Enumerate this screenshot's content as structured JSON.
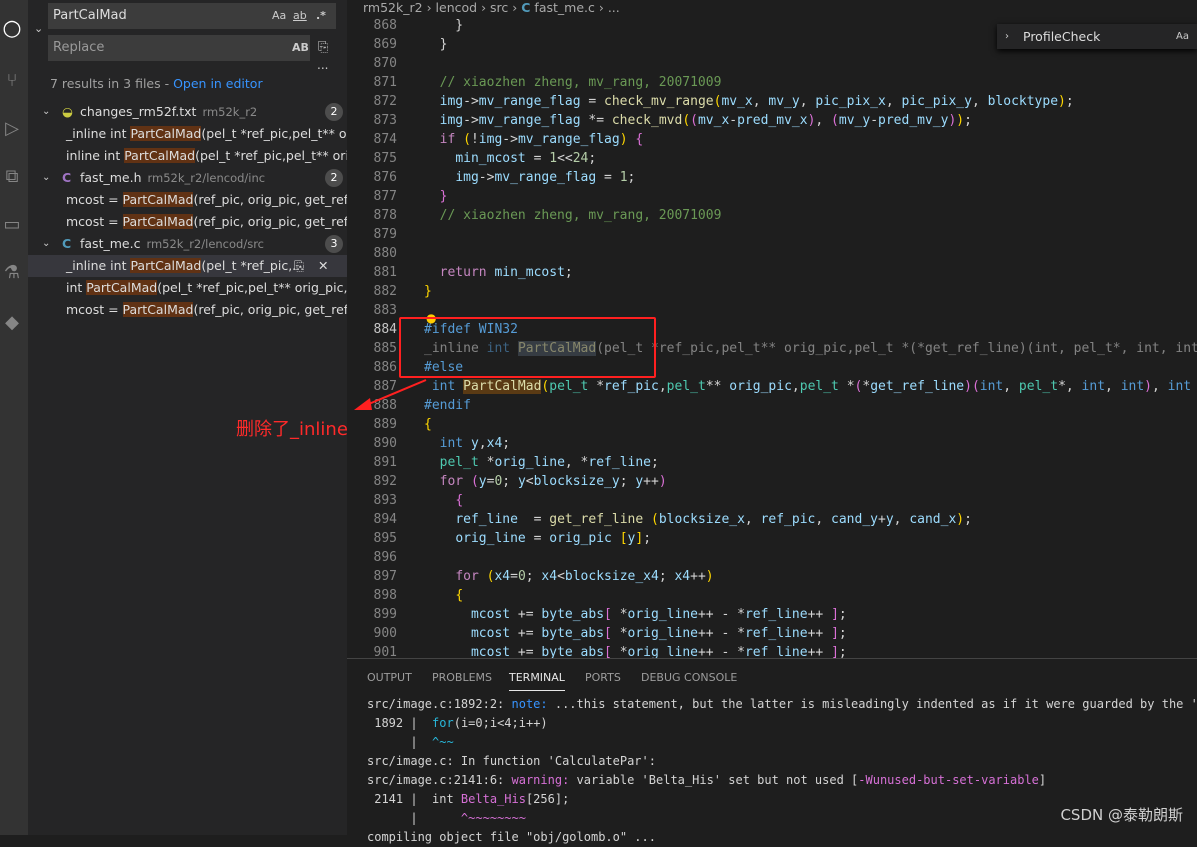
{
  "activity_bar": {
    "icons": [
      "search-icon",
      "source-control-icon",
      "run-debug-icon",
      "extensions-icon",
      "remote-explorer-icon",
      "testing-icon",
      "git-lens-icon"
    ]
  },
  "search": {
    "query": "PartCalMad",
    "replace_placeholder": "Replace",
    "match_case": "Aa",
    "whole_word": "ab",
    "regex": ".*",
    "preserve_case": "AB",
    "more": "...",
    "summary": "7 results in 3 files - ",
    "open_in_editor": "Open in editor"
  },
  "results": [
    {
      "name": "changes_rm52f.txt",
      "path": "rm52k_r2",
      "count": "2",
      "icon": "text-file-icon",
      "matches": [
        [
          "_inline int ",
          "PartCalMad",
          "(pel_t *ref_pic,pel_t** orig..."
        ],
        [
          "inline int ",
          "PartCalMad",
          "(pel_t *ref_pic,pel_t** orig_..."
        ]
      ]
    },
    {
      "name": "fast_me.h",
      "path": "rm52k_r2/lencod/inc",
      "count": "2",
      "icon": "C",
      "matches": [
        [
          "mcost = ",
          "PartCalMad",
          "(ref_pic, orig_pic, get_ref_li..."
        ],
        [
          "mcost = ",
          "PartCalMad",
          "(ref_pic, orig_pic, get_ref_li..."
        ]
      ]
    },
    {
      "name": "fast_me.c",
      "path": "rm52k_r2/lencod/src",
      "count": "3",
      "icon": "C",
      "matches": [
        [
          "_inline int ",
          "PartCalMad",
          "(pel_t *ref_pic,..."
        ],
        [
          "int ",
          "PartCalMad",
          "(pel_t *ref_pic,pel_t** orig_pic,pe..."
        ],
        [
          "mcost = ",
          "PartCalMad",
          "(ref_pic, orig_pic, get_ref_li..."
        ]
      ]
    }
  ],
  "breadcrumb": [
    "rm52k_r2",
    "lencod",
    "src",
    "fast_me.c",
    "..."
  ],
  "find_widget": {
    "value": "ProfileCheck",
    "match_case": "Aa"
  },
  "code": {
    "current_line": 884,
    "lines": [
      [
        868,
        [
          [
            "tx",
            "    }"
          ]
        ]
      ],
      [
        869,
        [
          [
            "tx",
            "  }"
          ]
        ]
      ],
      [
        870,
        []
      ],
      [
        871,
        [
          [
            "cm",
            "  // xiaozhen zheng, mv_rang, 20071009"
          ]
        ]
      ],
      [
        872,
        [
          [
            "tx",
            "  "
          ],
          [
            "vr",
            "img"
          ],
          [
            "tx",
            "->"
          ],
          [
            "vr",
            "mv_range_flag"
          ],
          [
            "tx",
            " = "
          ],
          [
            "fn",
            "check_mv_range"
          ],
          [
            "br",
            "("
          ],
          [
            "vr",
            "mv_x"
          ],
          [
            "tx",
            ", "
          ],
          [
            "vr",
            "mv_y"
          ],
          [
            "tx",
            ", "
          ],
          [
            "vr",
            "pic_pix_x"
          ],
          [
            "tx",
            ", "
          ],
          [
            "vr",
            "pic_pix_y"
          ],
          [
            "tx",
            ", "
          ],
          [
            "vr",
            "blocktype"
          ],
          [
            "br",
            ")"
          ],
          [
            "tx",
            ";"
          ]
        ]
      ],
      [
        873,
        [
          [
            "tx",
            "  "
          ],
          [
            "vr",
            "img"
          ],
          [
            "tx",
            "->"
          ],
          [
            "vr",
            "mv_range_flag"
          ],
          [
            "tx",
            " *= "
          ],
          [
            "fn",
            "check_mvd"
          ],
          [
            "br",
            "("
          ],
          [
            "bp",
            "("
          ],
          [
            "vr",
            "mv_x"
          ],
          [
            "tx",
            "-"
          ],
          [
            "vr",
            "pred_mv_x"
          ],
          [
            "bp",
            ")"
          ],
          [
            "tx",
            ", "
          ],
          [
            "bp",
            "("
          ],
          [
            "vr",
            "mv_y"
          ],
          [
            "tx",
            "-"
          ],
          [
            "vr",
            "pred_mv_y"
          ],
          [
            "bp",
            ")"
          ],
          [
            "br",
            ")"
          ],
          [
            "tx",
            ";"
          ]
        ]
      ],
      [
        874,
        [
          [
            "tx",
            "  "
          ],
          [
            "pp",
            "if"
          ],
          [
            "tx",
            " "
          ],
          [
            "br",
            "("
          ],
          [
            "tx",
            "!"
          ],
          [
            "vr",
            "img"
          ],
          [
            "tx",
            "->"
          ],
          [
            "vr",
            "mv_range_flag"
          ],
          [
            "br",
            ")"
          ],
          [
            "tx",
            " "
          ],
          [
            "bp",
            "{"
          ]
        ]
      ],
      [
        875,
        [
          [
            "tx",
            "    "
          ],
          [
            "vr",
            "min_mcost"
          ],
          [
            "tx",
            " = "
          ],
          [
            "nm",
            "1"
          ],
          [
            "tx",
            "<<"
          ],
          [
            "nm",
            "24"
          ],
          [
            "tx",
            ";"
          ]
        ]
      ],
      [
        876,
        [
          [
            "tx",
            "    "
          ],
          [
            "vr",
            "img"
          ],
          [
            "tx",
            "->"
          ],
          [
            "vr",
            "mv_range_flag"
          ],
          [
            "tx",
            " = "
          ],
          [
            "nm",
            "1"
          ],
          [
            "tx",
            ";"
          ]
        ]
      ],
      [
        877,
        [
          [
            "tx",
            "  "
          ],
          [
            "bp",
            "}"
          ]
        ]
      ],
      [
        878,
        [
          [
            "cm",
            "  // xiaozhen zheng, mv_rang, 20071009"
          ]
        ]
      ],
      [
        879,
        []
      ],
      [
        880,
        []
      ],
      [
        881,
        [
          [
            "tx",
            "  "
          ],
          [
            "pp",
            "return"
          ],
          [
            "tx",
            " "
          ],
          [
            "vr",
            "min_mcost"
          ],
          [
            "tx",
            ";"
          ]
        ]
      ],
      [
        882,
        [
          [
            "br",
            "}"
          ]
        ]
      ],
      [
        883,
        []
      ],
      [
        884,
        [
          [
            "kw",
            "#ifdef"
          ],
          [
            "tx",
            " "
          ],
          [
            "kw",
            "WIN32"
          ]
        ]
      ],
      [
        885,
        [
          [
            "dim",
            "_inline "
          ],
          [
            "dimkw",
            "int "
          ],
          [
            "hlw",
            "PartCalMad"
          ],
          [
            "dim",
            "(pel_t *ref_pic,pel_t** orig_pic,pel_t *(*get_ref_line)(int, pel_t*, int, int), int bl"
          ]
        ]
      ],
      [
        886,
        [
          [
            "kw",
            "#else"
          ]
        ]
      ],
      [
        887,
        [
          [
            "tx",
            " "
          ],
          [
            "kw",
            "int"
          ],
          [
            "tx",
            " "
          ],
          [
            "hlm",
            "PartCalMad"
          ],
          [
            "br",
            "("
          ],
          [
            "ty",
            "pel_t"
          ],
          [
            "tx",
            " *"
          ],
          [
            "vr",
            "ref_pic"
          ],
          [
            "tx",
            ","
          ],
          [
            "ty",
            "pel_t"
          ],
          [
            "tx",
            "** "
          ],
          [
            "vr",
            "orig_pic"
          ],
          [
            "tx",
            ","
          ],
          [
            "ty",
            "pel_t"
          ],
          [
            "tx",
            " *"
          ],
          [
            "bp",
            "("
          ],
          [
            "tx",
            "*"
          ],
          [
            "vr",
            "get_ref_line"
          ],
          [
            "bp",
            ")"
          ],
          [
            "bp",
            "("
          ],
          [
            "kw",
            "int"
          ],
          [
            "tx",
            ", "
          ],
          [
            "ty",
            "pel_t"
          ],
          [
            "tx",
            "*, "
          ],
          [
            "kw",
            "int"
          ],
          [
            "tx",
            ", "
          ],
          [
            "kw",
            "int"
          ],
          [
            "bp",
            ")"
          ],
          [
            "tx",
            ", "
          ],
          [
            "kw",
            "int"
          ],
          [
            "tx",
            " bl"
          ]
        ]
      ],
      [
        888,
        [
          [
            "kw",
            "#endif"
          ]
        ]
      ],
      [
        889,
        [
          [
            "br",
            "{"
          ]
        ]
      ],
      [
        890,
        [
          [
            "tx",
            "  "
          ],
          [
            "kw",
            "int"
          ],
          [
            "tx",
            " "
          ],
          [
            "vr",
            "y"
          ],
          [
            "tx",
            ","
          ],
          [
            "vr",
            "x4"
          ],
          [
            "tx",
            ";"
          ]
        ]
      ],
      [
        891,
        [
          [
            "tx",
            "  "
          ],
          [
            "ty",
            "pel_t"
          ],
          [
            "tx",
            " *"
          ],
          [
            "vr",
            "orig_line"
          ],
          [
            "tx",
            ", *"
          ],
          [
            "vr",
            "ref_line"
          ],
          [
            "tx",
            ";"
          ]
        ]
      ],
      [
        892,
        [
          [
            "tx",
            "  "
          ],
          [
            "pp",
            "for"
          ],
          [
            "tx",
            " "
          ],
          [
            "bp",
            "("
          ],
          [
            "vr",
            "y"
          ],
          [
            "tx",
            "="
          ],
          [
            "nm",
            "0"
          ],
          [
            "tx",
            "; "
          ],
          [
            "vr",
            "y"
          ],
          [
            "tx",
            "<"
          ],
          [
            "vr",
            "blocksize_y"
          ],
          [
            "tx",
            "; "
          ],
          [
            "vr",
            "y"
          ],
          [
            "tx",
            "++"
          ],
          [
            "bp",
            ")"
          ]
        ]
      ],
      [
        893,
        [
          [
            "tx",
            "    "
          ],
          [
            "bp",
            "{"
          ]
        ]
      ],
      [
        894,
        [
          [
            "tx",
            "    "
          ],
          [
            "vr",
            "ref_line"
          ],
          [
            "tx",
            "  = "
          ],
          [
            "fn",
            "get_ref_line"
          ],
          [
            "tx",
            " "
          ],
          [
            "br",
            "("
          ],
          [
            "vr",
            "blocksize_x"
          ],
          [
            "tx",
            ", "
          ],
          [
            "vr",
            "ref_pic"
          ],
          [
            "tx",
            ", "
          ],
          [
            "vr",
            "cand_y"
          ],
          [
            "tx",
            "+"
          ],
          [
            "vr",
            "y"
          ],
          [
            "tx",
            ", "
          ],
          [
            "vr",
            "cand_x"
          ],
          [
            "br",
            ")"
          ],
          [
            "tx",
            ";"
          ]
        ]
      ],
      [
        895,
        [
          [
            "tx",
            "    "
          ],
          [
            "vr",
            "orig_line"
          ],
          [
            "tx",
            " = "
          ],
          [
            "vr",
            "orig_pic"
          ],
          [
            "tx",
            " "
          ],
          [
            "br",
            "["
          ],
          [
            "vr",
            "y"
          ],
          [
            "br",
            "]"
          ],
          [
            "tx",
            ";"
          ]
        ]
      ],
      [
        896,
        []
      ],
      [
        897,
        [
          [
            "tx",
            "    "
          ],
          [
            "pp",
            "for"
          ],
          [
            "tx",
            " "
          ],
          [
            "br",
            "("
          ],
          [
            "vr",
            "x4"
          ],
          [
            "tx",
            "="
          ],
          [
            "nm",
            "0"
          ],
          [
            "tx",
            "; "
          ],
          [
            "vr",
            "x4"
          ],
          [
            "tx",
            "<"
          ],
          [
            "vr",
            "blocksize_x4"
          ],
          [
            "tx",
            "; "
          ],
          [
            "vr",
            "x4"
          ],
          [
            "tx",
            "++"
          ],
          [
            "br",
            ")"
          ]
        ]
      ],
      [
        898,
        [
          [
            "tx",
            "    "
          ],
          [
            "br",
            "{"
          ]
        ]
      ],
      [
        899,
        [
          [
            "tx",
            "      "
          ],
          [
            "vr",
            "mcost"
          ],
          [
            "tx",
            " += "
          ],
          [
            "vr",
            "byte_abs"
          ],
          [
            "bp",
            "["
          ],
          [
            "tx",
            " *"
          ],
          [
            "vr",
            "orig_line"
          ],
          [
            "tx",
            "++ - *"
          ],
          [
            "vr",
            "ref_line"
          ],
          [
            "tx",
            "++ "
          ],
          [
            "bp",
            "]"
          ],
          [
            "tx",
            ";"
          ]
        ]
      ],
      [
        900,
        [
          [
            "tx",
            "      "
          ],
          [
            "vr",
            "mcost"
          ],
          [
            "tx",
            " += "
          ],
          [
            "vr",
            "byte_abs"
          ],
          [
            "bp",
            "["
          ],
          [
            "tx",
            " *"
          ],
          [
            "vr",
            "orig_line"
          ],
          [
            "tx",
            "++ - *"
          ],
          [
            "vr",
            "ref_line"
          ],
          [
            "tx",
            "++ "
          ],
          [
            "bp",
            "]"
          ],
          [
            "tx",
            ";"
          ]
        ]
      ],
      [
        901,
        [
          [
            "tx",
            "      "
          ],
          [
            "vr",
            "mcost"
          ],
          [
            "tx",
            " += "
          ],
          [
            "vr",
            "byte_abs"
          ],
          [
            "bp",
            "["
          ],
          [
            "tx",
            " *"
          ],
          [
            "vr",
            "orig_line"
          ],
          [
            "tx",
            "++ - *"
          ],
          [
            "vr",
            "ref_line"
          ],
          [
            "tx",
            "++ "
          ],
          [
            "bp",
            "]"
          ],
          [
            "tx",
            ";"
          ]
        ]
      ]
    ]
  },
  "annotation": {
    "text": "删除了_inline",
    "color": "#ff2020"
  },
  "panel": {
    "tabs": [
      "OUTPUT",
      "PROBLEMS",
      "TERMINAL",
      "PORTS",
      "DEBUG CONSOLE"
    ],
    "active_tab": "TERMINAL",
    "lines": [
      [
        [
          "tx",
          "src/image.c:1892:2: "
        ],
        [
          "note",
          "note:"
        ],
        [
          "tx",
          " ...this statement, but the latter is misleadingly indented as if it were guarded by the 'for'"
        ]
      ],
      [
        [
          "tx",
          " 1892 |  "
        ],
        [
          "cy",
          "for"
        ],
        [
          "tx",
          "(i=0;i<4;i++)"
        ]
      ],
      [
        [
          "tx",
          "      |  "
        ],
        [
          "cy",
          "^~~"
        ]
      ],
      [
        [
          "tx",
          "src/image.c: In function 'CalculatePar':"
        ]
      ],
      [
        [
          "tx",
          "src/image.c:2141:6: "
        ],
        [
          "warn",
          "warning:"
        ],
        [
          "tx",
          " variable 'Belta_His' set but not used ["
        ],
        [
          "warn",
          "-Wunused-but-set-variable"
        ],
        [
          "tx",
          "]"
        ]
      ],
      [
        [
          "tx",
          " 2141 |  int "
        ],
        [
          "warn",
          "Belta_His"
        ],
        [
          "tx",
          "[256];"
        ]
      ],
      [
        [
          "tx",
          "      |      "
        ],
        [
          "warn",
          "^~~~~~~~~"
        ]
      ],
      [
        [
          "tx",
          "compiling object file \"obj/golomb.o\" ..."
        ]
      ]
    ]
  },
  "watermark": "CSDN @泰勒朗斯"
}
